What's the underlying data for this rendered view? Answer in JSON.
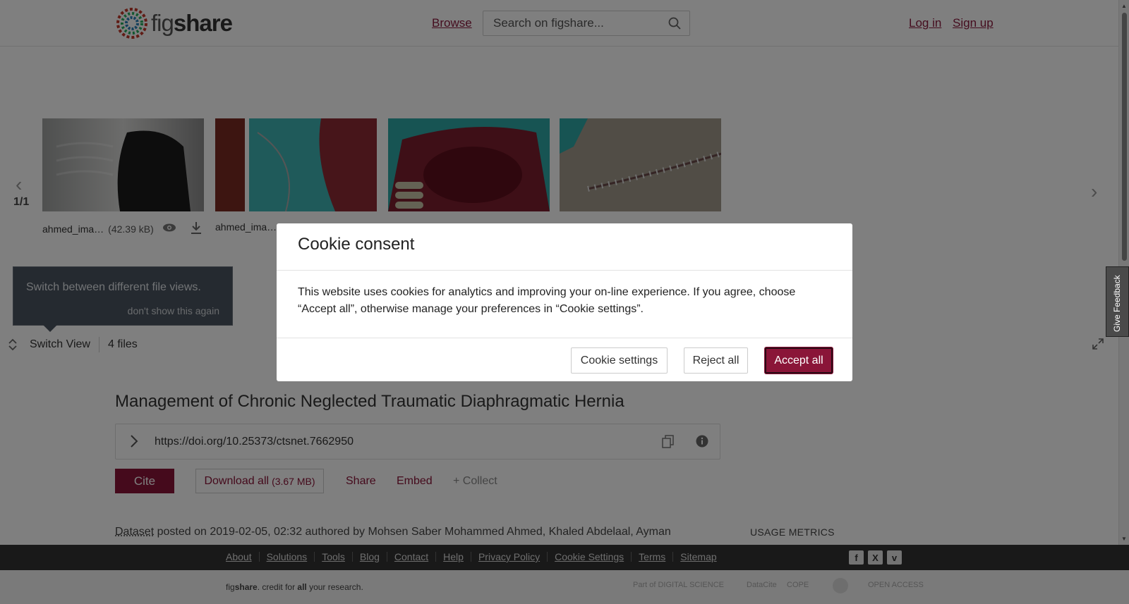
{
  "header": {
    "logo_prefix": "fig",
    "logo_suffix": "share",
    "browse": "Browse",
    "search_placeholder": "Search on figshare...",
    "login": "Log in",
    "signup": "Sign up"
  },
  "viewer": {
    "counter": "1/1",
    "files": [
      {
        "name": "ahmed_ima…",
        "size": "(42.39 kB)"
      },
      {
        "name": "ahmed_ima…",
        "size": ""
      },
      {
        "name": "",
        "size": ""
      },
      {
        "name": "",
        "size": ""
      }
    ],
    "tooltip_text": "Switch between different file views.",
    "tooltip_dismiss": "don't show this again",
    "switch_view": "Switch View",
    "files_count": "4 files"
  },
  "article": {
    "title": "Management of Chronic Neglected Traumatic Diaphragmatic Hernia",
    "doi": "https://doi.org/10.25373/ctsnet.7662950",
    "cite": "Cite",
    "download_all": "Download all",
    "download_size": "(3.67 MB)",
    "share": "Share",
    "embed": "Embed",
    "collect": "+ Collect",
    "item_type": "Dataset",
    "posted_text": " posted on 2019-02-05, 02:32 authored by Mohsen Saber Mohammed Ahmed, Khaled Abdelaal, Ayman",
    "usage_metrics": "USAGE METRICS"
  },
  "cookie": {
    "title": "Cookie consent",
    "body": "This website uses cookies for analytics and improving your on-line experience. If you agree, choose “Accept all”, otherwise manage your preferences in “Cookie settings”.",
    "settings": "Cookie settings",
    "reject": "Reject all",
    "accept": "Accept all"
  },
  "feedback": "Give Feedback",
  "footer": {
    "links": [
      "About",
      "Solutions",
      "Tools",
      "Blog",
      "Contact",
      "Help",
      "Privacy Policy",
      "Cookie Settings",
      "Terms",
      "Sitemap"
    ],
    "credit_fig": "fig",
    "credit_share": "share",
    "credit_mid": ". credit for ",
    "credit_all": "all",
    "credit_end": " your research.",
    "social": [
      "f",
      "X",
      "v"
    ],
    "partners": [
      "Part of DIGITAL SCIENCE",
      "DataCite",
      "COPE",
      "",
      "OPEN ACCESS"
    ]
  },
  "colors": {
    "brand": "#8a1538",
    "footer_bg": "#333333"
  }
}
